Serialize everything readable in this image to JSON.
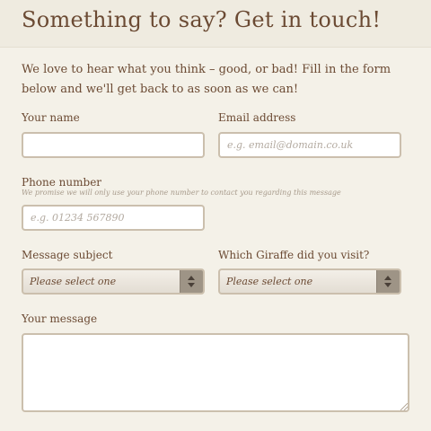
{
  "header": {
    "title": "Something to say? Get in touch!"
  },
  "intro": "We love to hear what you think – good, or bad! Fill in the form below and we'll get back to as soon as we can!",
  "form": {
    "name": {
      "label": "Your name",
      "value": "",
      "placeholder": ""
    },
    "email": {
      "label": "Email address",
      "value": "",
      "placeholder": "e.g. email@domain.co.uk"
    },
    "phone": {
      "label": "Phone number",
      "hint": "We promise we will only use your phone number to contact you regarding this message",
      "value": "",
      "placeholder": "e.g. 01234 567890"
    },
    "subject": {
      "label": "Message subject",
      "selected": "Please select one"
    },
    "giraffe": {
      "label": "Which Giraffe did you visit?",
      "selected": "Please select one"
    },
    "message": {
      "label": "Your message",
      "value": ""
    }
  },
  "icons": {
    "select_arrows": "up-down-chevron-icon",
    "resize": "resize-grip-icon"
  },
  "colors": {
    "background": "#f4f1e8",
    "header_background": "#efebe0",
    "text": "#6b4a33",
    "placeholder": "#b3aaa0",
    "input_border": "#cbbfad",
    "select_button": "#9e9486"
  }
}
